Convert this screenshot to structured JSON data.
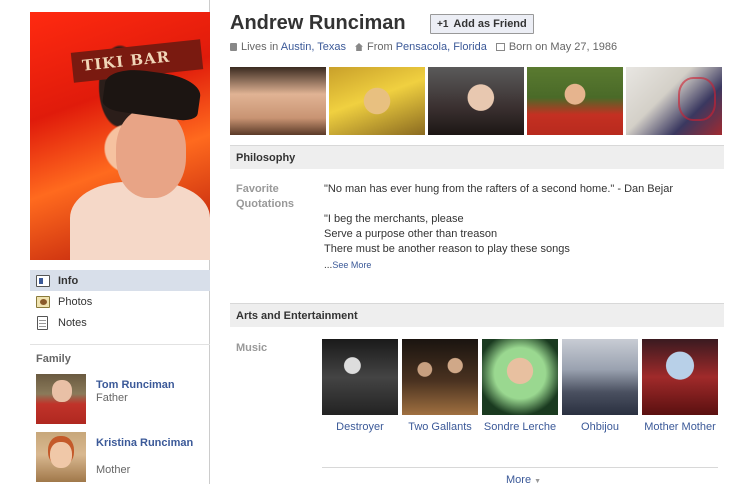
{
  "profile": {
    "name": "Andrew Runciman",
    "add_friend_label": "Add as Friend",
    "lives_in_prefix": "Lives in",
    "lives_in": "Austin, Texas",
    "from_prefix": "From",
    "from": "Pensacola, Florida",
    "born": "Born on May 27, 1986"
  },
  "left_nav": {
    "items": [
      {
        "label": "Info",
        "icon": "info-icon",
        "selected": true
      },
      {
        "label": "Photos",
        "icon": "photos-icon",
        "selected": false
      },
      {
        "label": "Notes",
        "icon": "notes-icon",
        "selected": false
      }
    ]
  },
  "family": {
    "heading": "Family",
    "members": [
      {
        "name": "Tom Runciman",
        "relation": "Father"
      },
      {
        "name": "Kristina Runciman",
        "relation": "Mother"
      }
    ]
  },
  "profile_picture": {
    "sign_text": "TIKI BAR"
  },
  "sections": {
    "philosophy": {
      "title": "Philosophy",
      "label": "Favorite Quotations",
      "quote_1": "\"No man has ever hung from the rafters of a second home.\" - Dan Bejar",
      "quote_2_lines": [
        "\"I beg the merchants, please",
        "Serve a purpose other than treason",
        "There must be another reason to play these songs"
      ],
      "ellipsis": "...",
      "see_more": "See More"
    },
    "arts": {
      "title": "Arts and Entertainment",
      "music_label": "Music",
      "music": [
        "Destroyer",
        "Two Gallants",
        "Sondre Lerche",
        "Ohbijou",
        "Mother Mother"
      ],
      "more_label": "More",
      "more_caret": "▼"
    }
  },
  "colors": {
    "link": "#3b5998",
    "section_header_bg": "#eeeeee",
    "selected_nav_bg": "#d8dfea",
    "label_gray": "#999999"
  }
}
